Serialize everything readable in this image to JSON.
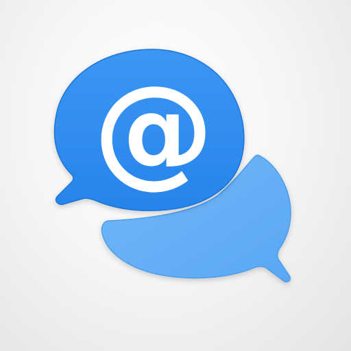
{
  "app_icon": {
    "icon_name": "chat-email-icon",
    "symbol": "@",
    "colors": {
      "front_bubble": "#2f8ef0",
      "front_bubble_dark": "#1f77dc",
      "back_bubble": "#64aff7",
      "back_bubble_dark": "#4c9cea",
      "symbol": "#ffffff"
    }
  }
}
